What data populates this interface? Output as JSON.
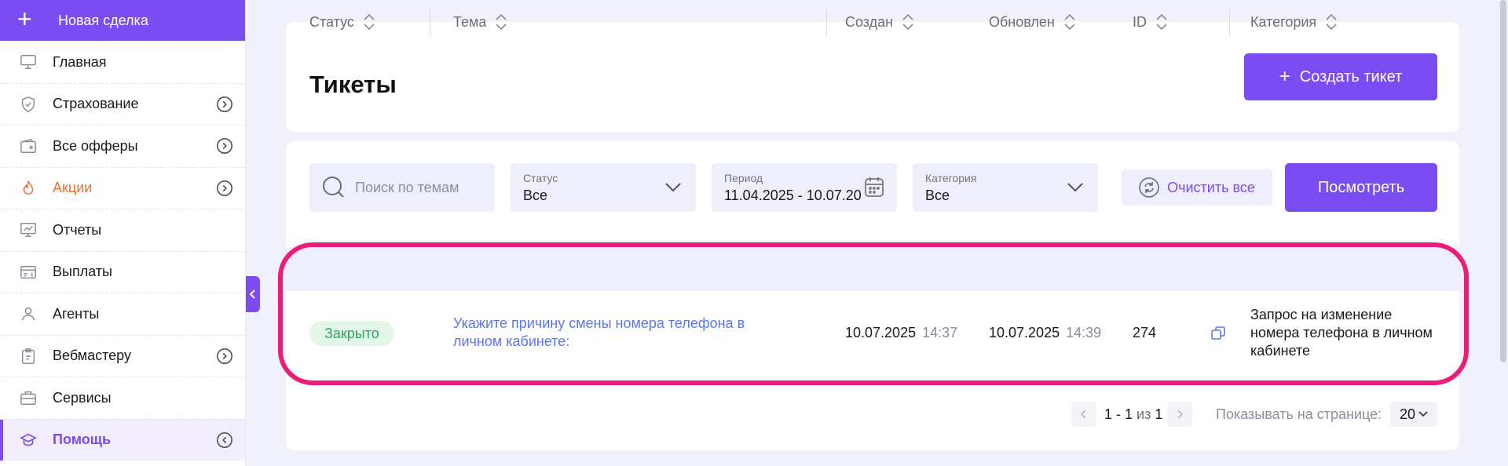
{
  "sidebar": {
    "new_deal_label": "Новая сделка",
    "items": [
      {
        "label": "Главная"
      },
      {
        "label": "Страхование"
      },
      {
        "label": "Все офферы"
      },
      {
        "label": "Акции"
      },
      {
        "label": "Отчеты"
      },
      {
        "label": "Выплаты"
      },
      {
        "label": "Агенты"
      },
      {
        "label": "Вебмастеру"
      },
      {
        "label": "Сервисы"
      },
      {
        "label": "Помощь"
      }
    ]
  },
  "header": {
    "title": "Тикеты",
    "create_button": "Создать тикет"
  },
  "filters": {
    "search_placeholder": "Поиск по темам",
    "status": {
      "caption": "Статус",
      "value": "Все"
    },
    "period": {
      "caption": "Период",
      "value": "11.04.2025 - 10.07.2025"
    },
    "category": {
      "caption": "Категория",
      "value": "Все"
    },
    "clear_label": "Очистить все",
    "view_label": "Посмотреть"
  },
  "table": {
    "columns": [
      "Статус",
      "Тема",
      "Создан",
      "Обновлен",
      "ID",
      "Категория"
    ],
    "rows": [
      {
        "status": "Закрыто",
        "topic": "Укажите причину смены номера телефона в личном кабинете:",
        "created_date": "10.07.2025",
        "created_time": "14:37",
        "updated_date": "10.07.2025",
        "updated_time": "14:39",
        "id": "274",
        "category": "Запрос на изменение номера телефона в личном кабинете"
      }
    ]
  },
  "pagination": {
    "range": "1 - 1",
    "of_label": "из",
    "total": "1",
    "per_page_label": "Показывать на странице:",
    "per_page_value": "20"
  },
  "colors": {
    "accent": "#7a4cf2",
    "highlight": "#ea1e78",
    "closed_badge": "#2fa55b",
    "link": "#5a77ee",
    "promo": "#f26b2c"
  }
}
